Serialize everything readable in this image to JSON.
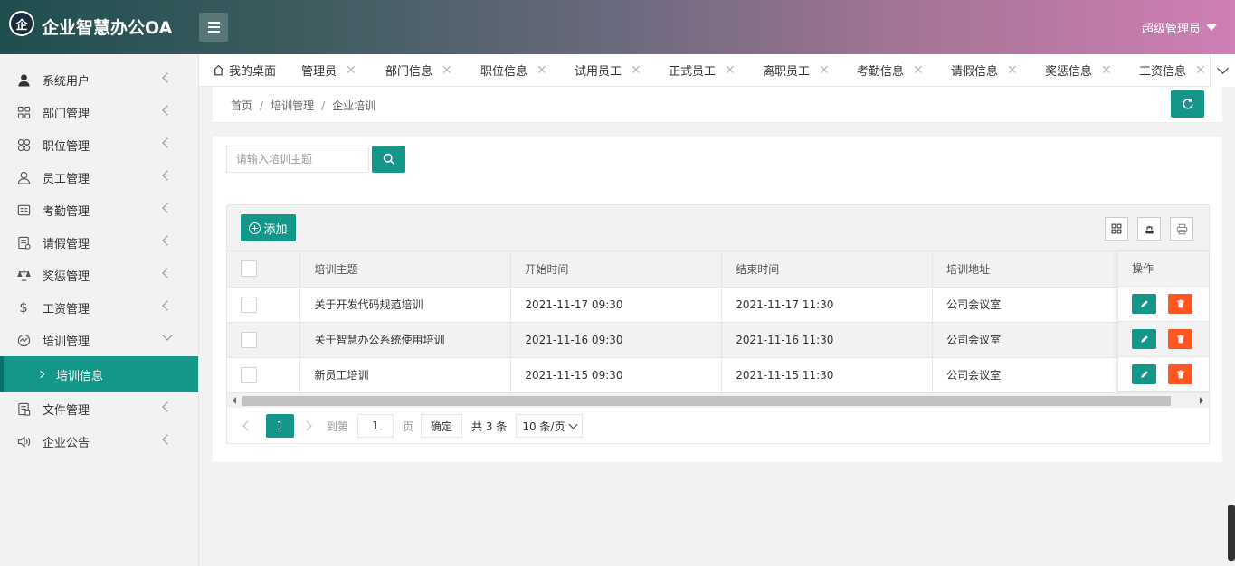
{
  "app": {
    "title": "企业智慧办公OA",
    "logo_glyph": "企"
  },
  "header": {
    "user_label": "超级管理员"
  },
  "sidebar": {
    "items": [
      {
        "label": "系统用户",
        "icon": "user-icon"
      },
      {
        "label": "部门管理",
        "icon": "grid-icon"
      },
      {
        "label": "职位管理",
        "icon": "clover-icon"
      },
      {
        "label": "员工管理",
        "icon": "person-icon"
      },
      {
        "label": "考勤管理",
        "icon": "calendar-icon"
      },
      {
        "label": "请假管理",
        "icon": "form-icon"
      },
      {
        "label": "奖惩管理",
        "icon": "scale-icon"
      },
      {
        "label": "工资管理",
        "icon": "dollar-icon"
      },
      {
        "label": "培训管理",
        "icon": "chart-icon"
      },
      {
        "label": "文件管理",
        "icon": "file-icon"
      },
      {
        "label": "企业公告",
        "icon": "speaker-icon"
      }
    ],
    "active_sub": "培训信息"
  },
  "tabs": [
    {
      "label": "我的桌面",
      "closable": false,
      "icon": "home-icon"
    },
    {
      "label": "管理员",
      "closable": true
    },
    {
      "label": "部门信息",
      "closable": true
    },
    {
      "label": "职位信息",
      "closable": true
    },
    {
      "label": "试用员工",
      "closable": true
    },
    {
      "label": "正式员工",
      "closable": true
    },
    {
      "label": "离职员工",
      "closable": true
    },
    {
      "label": "考勤信息",
      "closable": true
    },
    {
      "label": "请假信息",
      "closable": true
    },
    {
      "label": "奖惩信息",
      "closable": true
    },
    {
      "label": "工资信息",
      "closable": true
    }
  ],
  "breadcrumb": {
    "items": [
      "首页",
      "培训管理",
      "企业培训"
    ],
    "separator": "/"
  },
  "search": {
    "placeholder": "请输入培训主题",
    "value": ""
  },
  "toolbar": {
    "add_label": "添加"
  },
  "table": {
    "columns": [
      "培训主题",
      "开始时间",
      "结束时间",
      "培训地址"
    ],
    "action_column": "操作",
    "rows": [
      {
        "topic": "关于开发代码规范培训",
        "start": "2021-11-17 09:30",
        "end": "2021-11-17 11:30",
        "address": "公司会议室"
      },
      {
        "topic": "关于智慧办公系统使用培训",
        "start": "2021-11-16 09:30",
        "end": "2021-11-16 11:30",
        "address": "公司会议室"
      },
      {
        "topic": "新员工培训",
        "start": "2021-11-15 09:30",
        "end": "2021-11-15 11:30",
        "address": "公司会议室"
      }
    ]
  },
  "pager": {
    "current_page": "1",
    "goto_label": "到第",
    "page_input": "1",
    "page_unit": "页",
    "confirm_label": "确定",
    "total_label": "共 3 条",
    "page_size": "10 条/页"
  },
  "colors": {
    "accent": "#149688",
    "danger": "#ff5722"
  }
}
